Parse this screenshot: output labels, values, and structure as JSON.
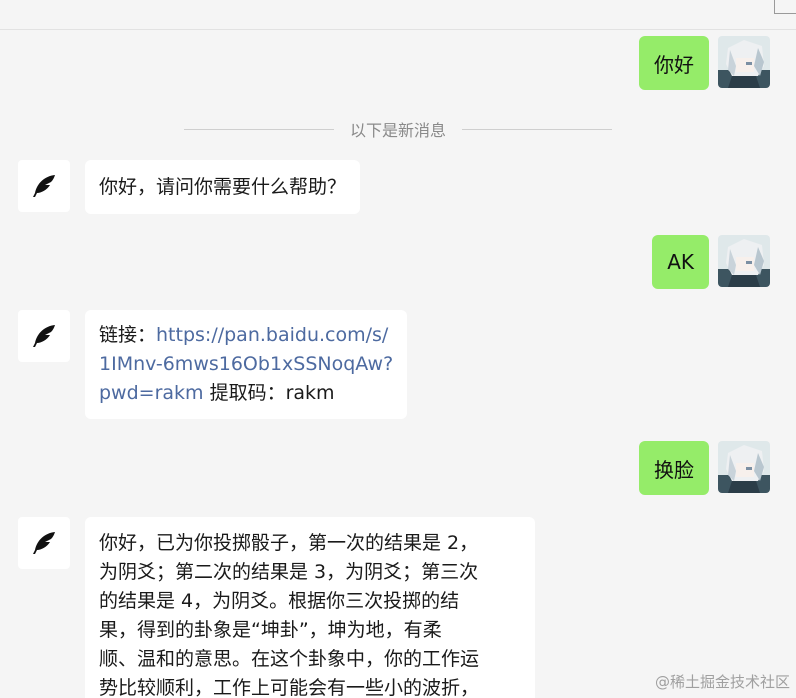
{
  "divider_text": "以下是新消息",
  "messages": [
    {
      "from": "user",
      "text": "你好"
    },
    {
      "from": "bot",
      "text": "你好，请问你需要什么帮助？"
    },
    {
      "from": "user",
      "text": "AK"
    },
    {
      "from": "bot",
      "prefix": "链接：",
      "link_line1": "https://pan.baidu.com/s/",
      "link_line2": "1IMnv-6mws16Ob1xSSNoqAw?",
      "link_line3": "pwd=rakm",
      "suffix": " 提取码：rakm"
    },
    {
      "from": "user",
      "text": "换脸"
    },
    {
      "from": "bot",
      "lines": [
        "你好，已为你投掷骰子，第一次的结果是 2，",
        "为阴爻；第二次的结果是 3，为阴爻；第三次",
        "的结果是 4，为阴爻。根据你三次投掷的结",
        "果，得到的卦象是“坤卦”，坤为地，有柔",
        "顺、温和的意思。在这个卦象中，你的工作运",
        "势比较顺利，工作上可能会有一些小的波折，"
      ]
    }
  ],
  "watermark": "@稀土掘金技术社区",
  "colors": {
    "user_bubble": "#95ec69",
    "bot_bubble": "#ffffff",
    "link": "#4d6aa0",
    "background": "#f5f5f5"
  },
  "icons": {
    "bot_avatar": "feather-icon",
    "user_avatar": "anime-avatar"
  }
}
